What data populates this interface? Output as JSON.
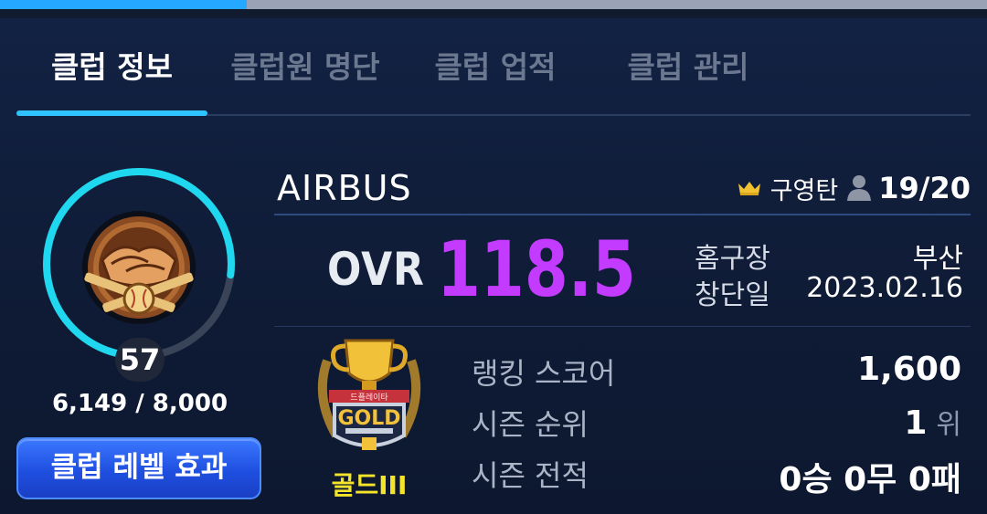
{
  "tabs": [
    {
      "label": "클럽 정보",
      "active": true
    },
    {
      "label": "클럽원 명단",
      "active": false
    },
    {
      "label": "클럽 업적",
      "active": false
    },
    {
      "label": "클럽 관리",
      "active": false
    }
  ],
  "club": {
    "name": "AIRBUS",
    "owner": "구영탄",
    "members": "19/20",
    "ovr_label": "OVR",
    "ovr_value": "118.5",
    "home_label": "홈구장",
    "home_value": "부산",
    "founded_label": "창단일",
    "founded_value": "2023.02.16"
  },
  "level": {
    "value": "57",
    "exp_text": "6,149 / 8,000",
    "progress": 0.769,
    "button_label": "클럽 레벨 효과"
  },
  "tier": {
    "name": "골드III",
    "badge_text": "GOLD",
    "ribbon_text": "드플레이타",
    "color": "#f5e52a"
  },
  "stats": [
    {
      "label": "랭킹 스코어",
      "value": "1,600",
      "unit": ""
    },
    {
      "label": "시즌 순위",
      "value": "1",
      "unit": "위"
    },
    {
      "label": "시즌 전적",
      "value": "0승 0무 0패",
      "unit": ""
    }
  ],
  "colors": {
    "accent": "#2ec3ff",
    "ovr": "#c23bff",
    "button": "#1f4fe0"
  },
  "icons": {
    "owner": "crown-icon",
    "members": "person-icon",
    "emblem": "handshake-baseball-emblem"
  }
}
